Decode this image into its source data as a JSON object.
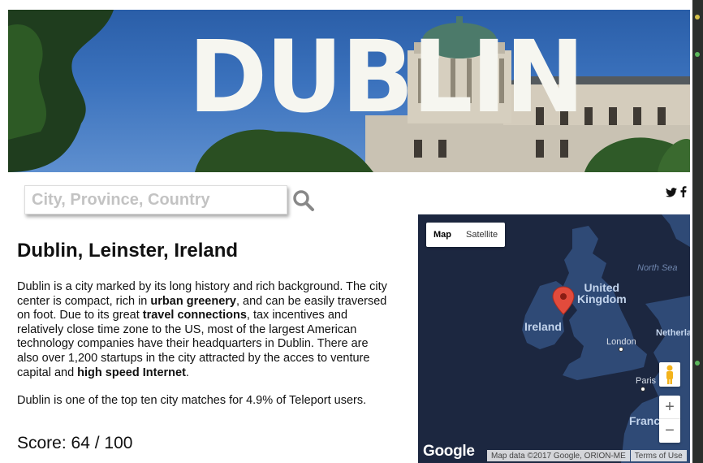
{
  "hero": {
    "title": "DUBLIN"
  },
  "search": {
    "placeholder": "City, Province, Country",
    "value": ""
  },
  "social": {
    "twitter_icon": "twitter-icon",
    "facebook_icon": "facebook-icon"
  },
  "city": {
    "heading": "Dublin, Leinster, Ireland",
    "description": {
      "p1": "Dublin is a city marked by its long history and rich background. The city center is compact, rich in ",
      "b1": "urban greenery",
      "p2": ", and can be easily traversed on foot. Due to its great ",
      "b2": "travel connections",
      "p3": ", tax incentives and relatively close time zone to the US, most of the largest American technology companies have their headquarters in Dublin. There are also over 1,200 startups in the city attracted by the acces to venture capital and ",
      "b3": "high speed Internet",
      "p4": "."
    },
    "match_text": "Dublin is one of the top ten city matches for 4.9% of Teleport users.",
    "score": "Score: 64 / 100"
  },
  "map": {
    "type_buttons": [
      "Map",
      "Satellite"
    ],
    "selected_type": "Map",
    "labels": {
      "north_sea": "North Sea",
      "uk": "United\nKingdom",
      "ireland": "Ireland",
      "london": "London",
      "netherlands": "Netherla",
      "paris": "Paris",
      "france": "Franc"
    },
    "zoom_in": "+",
    "zoom_out": "−",
    "google": "Google",
    "attribution": "Map data ©2017 Google, ORION-ME",
    "terms": "Terms of Use",
    "marker_color": "#e24b3c"
  },
  "colors": {
    "sea": "#1c2740",
    "land": "#2f4a76",
    "marker": "#e24b3c"
  }
}
